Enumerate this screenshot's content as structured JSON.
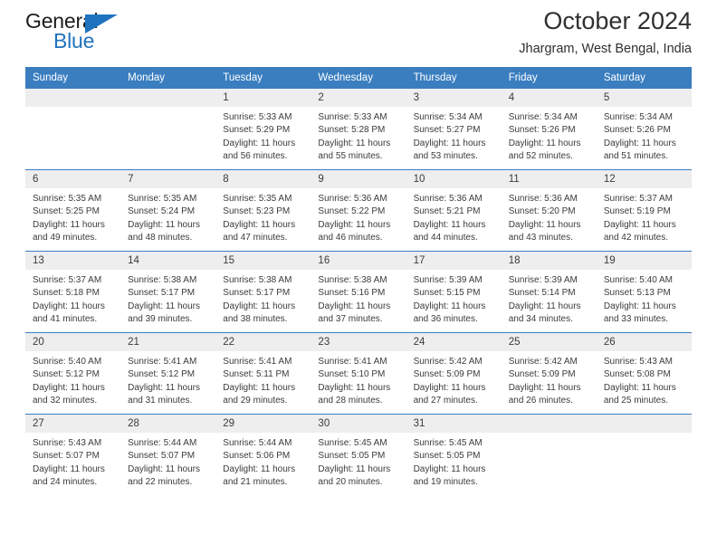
{
  "brand": {
    "name_top": "General",
    "name_bottom": "Blue",
    "accent_color": "#1f72bd"
  },
  "header": {
    "month_title": "October 2024",
    "location": "Jhargram, West Bengal, India"
  },
  "calendar": {
    "header_color": "#3a7ec0",
    "daynum_band_color": "#eeeeee",
    "weekdays": [
      "Sunday",
      "Monday",
      "Tuesday",
      "Wednesday",
      "Thursday",
      "Friday",
      "Saturday"
    ],
    "weeks": [
      [
        {
          "day": "",
          "lines": []
        },
        {
          "day": "",
          "lines": []
        },
        {
          "day": "1",
          "lines": [
            "Sunrise: 5:33 AM",
            "Sunset: 5:29 PM",
            "Daylight: 11 hours",
            "and 56 minutes."
          ]
        },
        {
          "day": "2",
          "lines": [
            "Sunrise: 5:33 AM",
            "Sunset: 5:28 PM",
            "Daylight: 11 hours",
            "and 55 minutes."
          ]
        },
        {
          "day": "3",
          "lines": [
            "Sunrise: 5:34 AM",
            "Sunset: 5:27 PM",
            "Daylight: 11 hours",
            "and 53 minutes."
          ]
        },
        {
          "day": "4",
          "lines": [
            "Sunrise: 5:34 AM",
            "Sunset: 5:26 PM",
            "Daylight: 11 hours",
            "and 52 minutes."
          ]
        },
        {
          "day": "5",
          "lines": [
            "Sunrise: 5:34 AM",
            "Sunset: 5:26 PM",
            "Daylight: 11 hours",
            "and 51 minutes."
          ]
        }
      ],
      [
        {
          "day": "6",
          "lines": [
            "Sunrise: 5:35 AM",
            "Sunset: 5:25 PM",
            "Daylight: 11 hours",
            "and 49 minutes."
          ]
        },
        {
          "day": "7",
          "lines": [
            "Sunrise: 5:35 AM",
            "Sunset: 5:24 PM",
            "Daylight: 11 hours",
            "and 48 minutes."
          ]
        },
        {
          "day": "8",
          "lines": [
            "Sunrise: 5:35 AM",
            "Sunset: 5:23 PM",
            "Daylight: 11 hours",
            "and 47 minutes."
          ]
        },
        {
          "day": "9",
          "lines": [
            "Sunrise: 5:36 AM",
            "Sunset: 5:22 PM",
            "Daylight: 11 hours",
            "and 46 minutes."
          ]
        },
        {
          "day": "10",
          "lines": [
            "Sunrise: 5:36 AM",
            "Sunset: 5:21 PM",
            "Daylight: 11 hours",
            "and 44 minutes."
          ]
        },
        {
          "day": "11",
          "lines": [
            "Sunrise: 5:36 AM",
            "Sunset: 5:20 PM",
            "Daylight: 11 hours",
            "and 43 minutes."
          ]
        },
        {
          "day": "12",
          "lines": [
            "Sunrise: 5:37 AM",
            "Sunset: 5:19 PM",
            "Daylight: 11 hours",
            "and 42 minutes."
          ]
        }
      ],
      [
        {
          "day": "13",
          "lines": [
            "Sunrise: 5:37 AM",
            "Sunset: 5:18 PM",
            "Daylight: 11 hours",
            "and 41 minutes."
          ]
        },
        {
          "day": "14",
          "lines": [
            "Sunrise: 5:38 AM",
            "Sunset: 5:17 PM",
            "Daylight: 11 hours",
            "and 39 minutes."
          ]
        },
        {
          "day": "15",
          "lines": [
            "Sunrise: 5:38 AM",
            "Sunset: 5:17 PM",
            "Daylight: 11 hours",
            "and 38 minutes."
          ]
        },
        {
          "day": "16",
          "lines": [
            "Sunrise: 5:38 AM",
            "Sunset: 5:16 PM",
            "Daylight: 11 hours",
            "and 37 minutes."
          ]
        },
        {
          "day": "17",
          "lines": [
            "Sunrise: 5:39 AM",
            "Sunset: 5:15 PM",
            "Daylight: 11 hours",
            "and 36 minutes."
          ]
        },
        {
          "day": "18",
          "lines": [
            "Sunrise: 5:39 AM",
            "Sunset: 5:14 PM",
            "Daylight: 11 hours",
            "and 34 minutes."
          ]
        },
        {
          "day": "19",
          "lines": [
            "Sunrise: 5:40 AM",
            "Sunset: 5:13 PM",
            "Daylight: 11 hours",
            "and 33 minutes."
          ]
        }
      ],
      [
        {
          "day": "20",
          "lines": [
            "Sunrise: 5:40 AM",
            "Sunset: 5:12 PM",
            "Daylight: 11 hours",
            "and 32 minutes."
          ]
        },
        {
          "day": "21",
          "lines": [
            "Sunrise: 5:41 AM",
            "Sunset: 5:12 PM",
            "Daylight: 11 hours",
            "and 31 minutes."
          ]
        },
        {
          "day": "22",
          "lines": [
            "Sunrise: 5:41 AM",
            "Sunset: 5:11 PM",
            "Daylight: 11 hours",
            "and 29 minutes."
          ]
        },
        {
          "day": "23",
          "lines": [
            "Sunrise: 5:41 AM",
            "Sunset: 5:10 PM",
            "Daylight: 11 hours",
            "and 28 minutes."
          ]
        },
        {
          "day": "24",
          "lines": [
            "Sunrise: 5:42 AM",
            "Sunset: 5:09 PM",
            "Daylight: 11 hours",
            "and 27 minutes."
          ]
        },
        {
          "day": "25",
          "lines": [
            "Sunrise: 5:42 AM",
            "Sunset: 5:09 PM",
            "Daylight: 11 hours",
            "and 26 minutes."
          ]
        },
        {
          "day": "26",
          "lines": [
            "Sunrise: 5:43 AM",
            "Sunset: 5:08 PM",
            "Daylight: 11 hours",
            "and 25 minutes."
          ]
        }
      ],
      [
        {
          "day": "27",
          "lines": [
            "Sunrise: 5:43 AM",
            "Sunset: 5:07 PM",
            "Daylight: 11 hours",
            "and 24 minutes."
          ]
        },
        {
          "day": "28",
          "lines": [
            "Sunrise: 5:44 AM",
            "Sunset: 5:07 PM",
            "Daylight: 11 hours",
            "and 22 minutes."
          ]
        },
        {
          "day": "29",
          "lines": [
            "Sunrise: 5:44 AM",
            "Sunset: 5:06 PM",
            "Daylight: 11 hours",
            "and 21 minutes."
          ]
        },
        {
          "day": "30",
          "lines": [
            "Sunrise: 5:45 AM",
            "Sunset: 5:05 PM",
            "Daylight: 11 hours",
            "and 20 minutes."
          ]
        },
        {
          "day": "31",
          "lines": [
            "Sunrise: 5:45 AM",
            "Sunset: 5:05 PM",
            "Daylight: 11 hours",
            "and 19 minutes."
          ]
        },
        {
          "day": "",
          "lines": []
        },
        {
          "day": "",
          "lines": []
        }
      ]
    ]
  }
}
